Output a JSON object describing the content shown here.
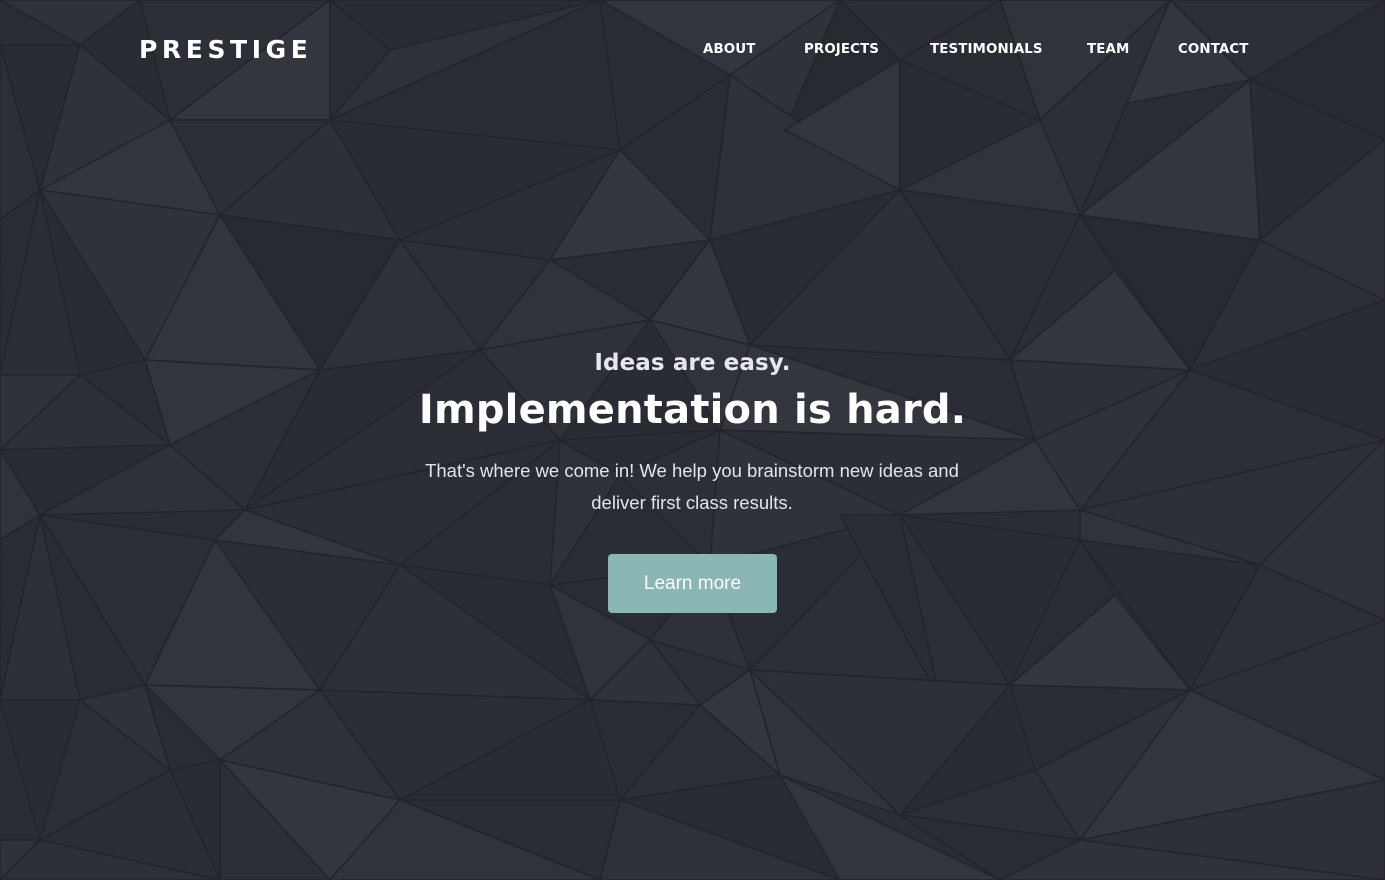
{
  "brand": {
    "logo_text": "PRESTIGE"
  },
  "nav": {
    "items": [
      {
        "label": "ABOUT"
      },
      {
        "label": "PROJECTS"
      },
      {
        "label": "TESTIMONIALS"
      },
      {
        "label": "TEAM"
      },
      {
        "label": "CONTACT"
      }
    ]
  },
  "hero": {
    "tagline_small": "Ideas are easy.",
    "tagline_big": "Implementation is hard.",
    "description": "That's where we come in! We help you brainstorm new ideas and deliver first class results.",
    "cta_label": "Learn more"
  },
  "colors": {
    "background": "#2b2d36",
    "accent": "#8ab7b3",
    "text": "#ffffff"
  }
}
